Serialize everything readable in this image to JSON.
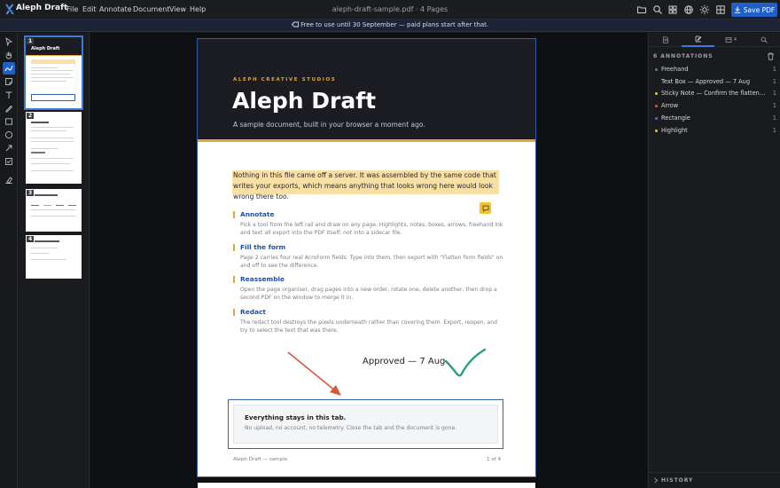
{
  "app": {
    "name": "Aleph Draft",
    "file_title": "aleph-draft-sample.pdf · 4 Pages",
    "menus": [
      "File",
      "Edit",
      "Annotate",
      "Document",
      "View",
      "Help"
    ],
    "save_label": "Save PDF",
    "accent": "#1f5fc9"
  },
  "banner": {
    "text": "Free to use until 30 September — paid plans start after that."
  },
  "toolbar_icons": [
    "open-folder-icon",
    "search-icon",
    "grid-icon",
    "globe-icon",
    "sun-icon",
    "layout-icon"
  ],
  "tools": [
    "select-tool",
    "pan-tool",
    "freehand-tool",
    "sticky-note-tool",
    "text-tool",
    "pen-tool",
    "rectangle-tool",
    "ellipse-tool",
    "arrow-tool",
    "form-field-tool",
    "redact-tool"
  ],
  "active_tool": "freehand-tool",
  "thumbnails": [
    {
      "num": "1",
      "title": "Aleph Draft"
    },
    {
      "num": "2",
      "title": ""
    },
    {
      "num": "3",
      "title": ""
    },
    {
      "num": "4",
      "title": ""
    }
  ],
  "document": {
    "studio": "ALEPH CREATIVE STUDIOS",
    "title": "Aleph Draft",
    "subtitle": "A sample document, built in your browser a moment ago.",
    "highlight_text": "Nothing in this file came off a server. It was assembled by the same code that writes your exports, which means anything that looks wrong here would look wrong there too.",
    "sections": [
      {
        "heading": "Annotate",
        "body": "Pick a tool from the left rail and draw on any page. Highlights, notes, boxes, arrows, freehand ink and text all export into the PDF itself, not into a sidecar file."
      },
      {
        "heading": "Fill the form",
        "body": "Page 2 carries four real AcroForm fields. Type into them, then export with \"Flatten form fields\" on and off to see the difference."
      },
      {
        "heading": "Reassemble",
        "body": "Open the page organiser, drag pages into a new order, rotate one, delete another, then drop a second PDF on the window to merge it in."
      },
      {
        "heading": "Redact",
        "body": "The redact tool destroys the pixels underneath rather than covering them. Export, reopen, and try to select the text that was there."
      }
    ],
    "approved_text": "Approved — 7 Aug",
    "callout_title": "Everything stays in this tab.",
    "callout_body": "No upload, no account, no telemetry. Close the tab and the document is gone.",
    "footer_left": "Aleph Draft — sample",
    "footer_right": "1 of 4",
    "colors": {
      "highlight": "#f8dfa6",
      "accent_gold": "#e0a83a",
      "arrow": "#d9573b",
      "ink": "#2a9d7a",
      "rect": "#2f66b3"
    }
  },
  "right_panel": {
    "tabs": [
      {
        "name": "document-tab-icon",
        "badge": ""
      },
      {
        "name": "annotations-tab-icon",
        "badge": ""
      },
      {
        "name": "layers-tab-icon",
        "badge": "4"
      },
      {
        "name": "search-tab-icon",
        "badge": ""
      }
    ],
    "active_tab": 1,
    "count_label": "6 ANNOTATIONS",
    "annotations": [
      {
        "label": "Freehand",
        "page": "1",
        "color": "#2a9d7a"
      },
      {
        "label": "Text Box — Approved — 7 Aug",
        "page": "1",
        "color": ""
      },
      {
        "label": "Sticky Note — Confirm the flatten behaviour",
        "page": "1",
        "color": "#f1c232"
      },
      {
        "label": "Arrow",
        "page": "1",
        "color": "#d9573b"
      },
      {
        "label": "Rectangle",
        "page": "1",
        "color": "#3a7bd5"
      },
      {
        "label": "Highlight",
        "page": "1",
        "color": "#f1c232"
      }
    ],
    "history_label": "HISTORY"
  }
}
